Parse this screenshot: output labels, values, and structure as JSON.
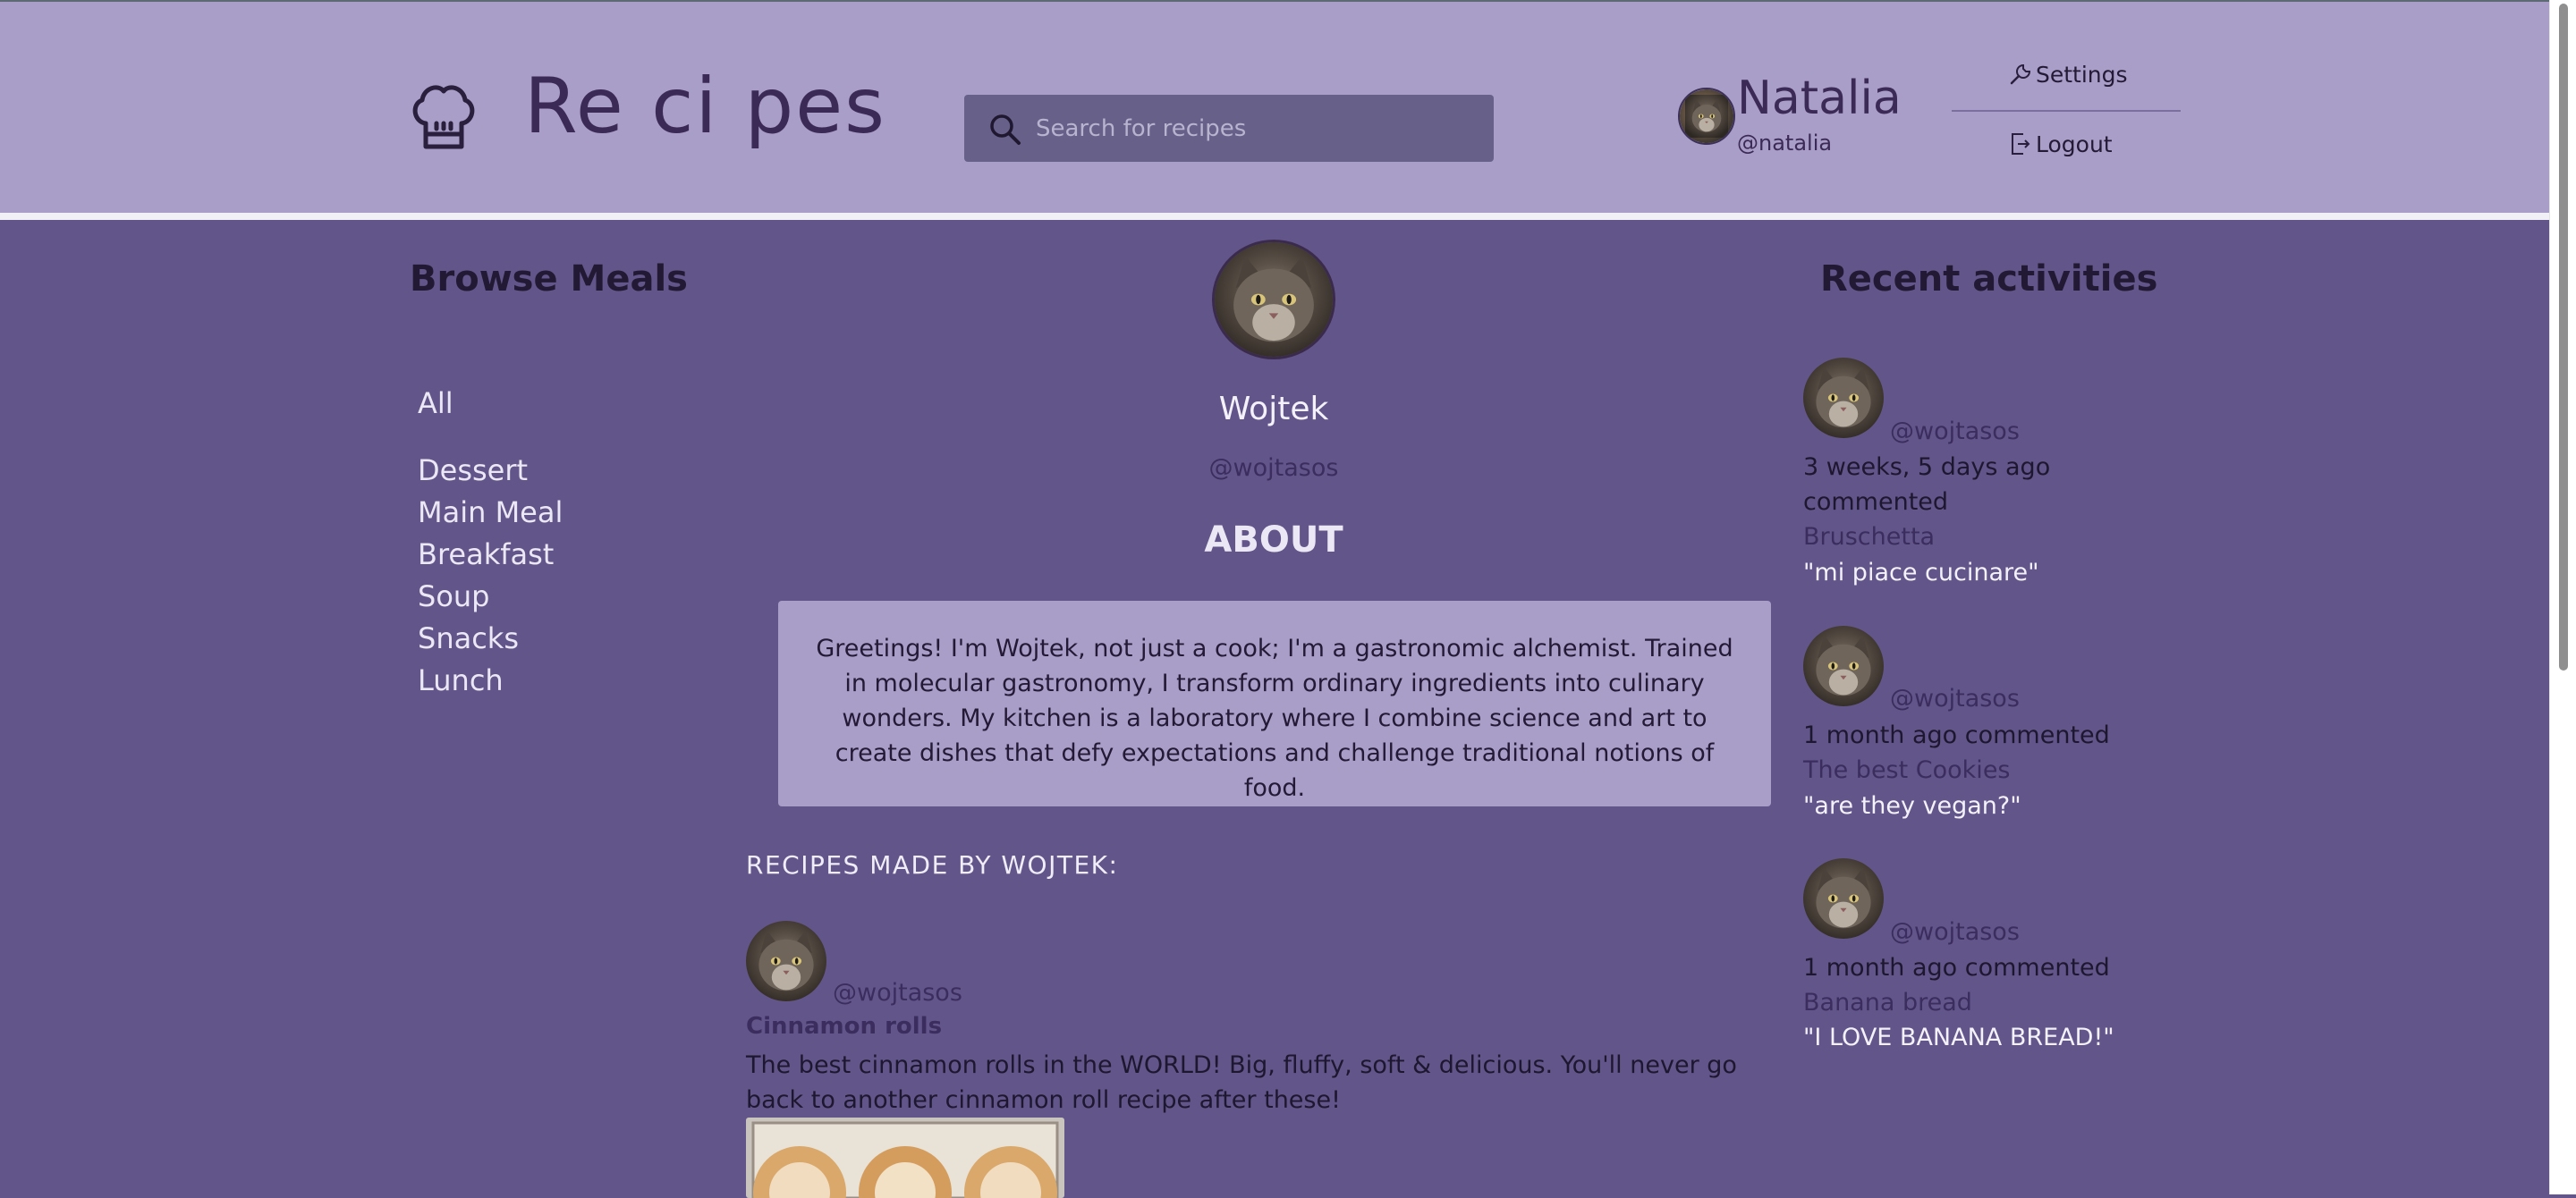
{
  "colors": {
    "header_bg": "#a89ec8",
    "main_bg": "#625589",
    "accent_dark": "#3b2a55",
    "search_bg": "#676089",
    "about_bg": "#a89ec8"
  },
  "header": {
    "logo_icon": "chef-hat-icon",
    "logo_text": "Re ci pes",
    "search": {
      "icon": "search-icon",
      "placeholder": "Search for recipes",
      "value": ""
    },
    "user": {
      "name": "Natalia",
      "handle": "@natalia"
    },
    "menu": [
      {
        "icon": "wrench-icon",
        "label": "Settings"
      },
      {
        "icon": "logout-icon",
        "label": "Logout"
      }
    ]
  },
  "browse": {
    "title": "Browse Meals",
    "items": [
      "All",
      "Dessert",
      "Main Meal",
      "Breakfast",
      "Soup",
      "Snacks",
      "Lunch"
    ]
  },
  "profile": {
    "name": "Wojtek",
    "handle": "@wojtasos",
    "about_title": "ABOUT",
    "about_text": "Greetings! I'm Wojtek, not just a cook; I'm a gastronomic alchemist. Trained in molecular gastronomy, I transform ordinary ingredients into culinary wonders. My kitchen is a laboratory where I combine science and art to create dishes that defy expectations and challenge traditional notions of food."
  },
  "recipes": {
    "heading": "RECIPES MADE BY WOJTEK:",
    "items": [
      {
        "author": "@wojtasos",
        "title": "Cinnamon rolls",
        "description": "The best cinnamon rolls in the WORLD! Big, fluffy, soft & delicious. You'll never go back to another cinnamon roll recipe after these!"
      }
    ]
  },
  "activities": {
    "title": "Recent activities",
    "items": [
      {
        "user": "@wojtasos",
        "time": "3 weeks, 5 days ago",
        "action": "commented",
        "recipe": "Bruschetta",
        "comment": "\"mi piace cucinare\""
      },
      {
        "user": "@wojtasos",
        "time": "1 month ago commented",
        "action": "",
        "recipe": "The best Cookies",
        "comment": "\"are they vegan?\""
      },
      {
        "user": "@wojtasos",
        "time": "1 month ago commented",
        "action": "",
        "recipe": "Banana bread",
        "comment": "\"I LOVE BANANA BREAD!\""
      }
    ]
  }
}
